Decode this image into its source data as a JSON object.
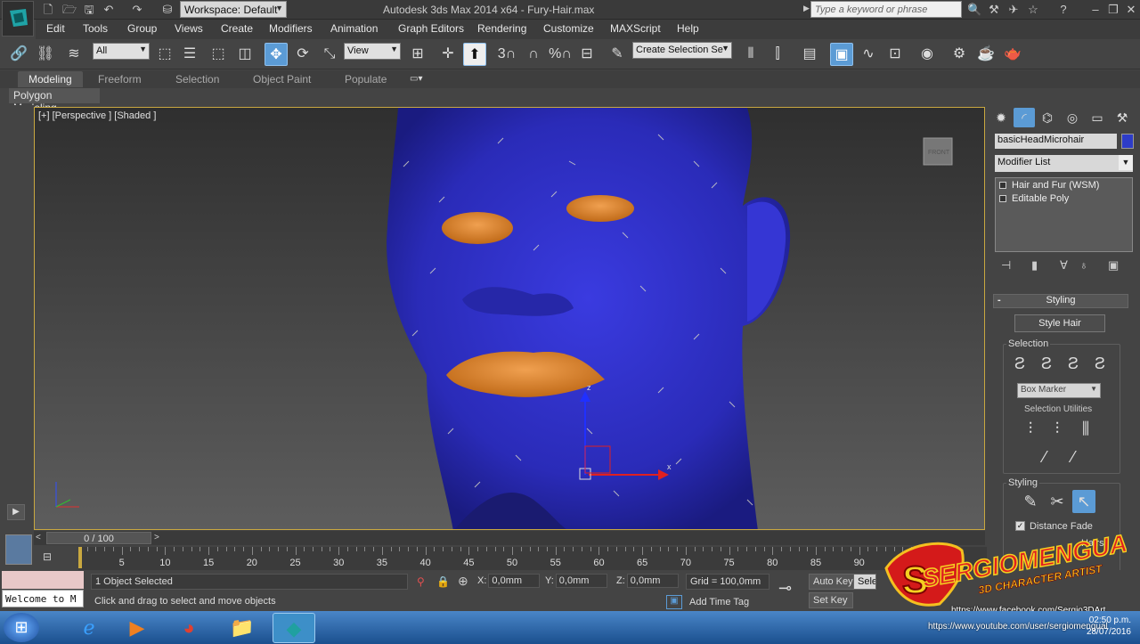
{
  "app": {
    "title": "Autodesk 3ds Max  2014 x64  -    Fury-Hair.max",
    "workspace": "Workspace: Default",
    "search_placeholder": "Type a keyword or phrase",
    "logo_icon": "3dsmax-logo-icon"
  },
  "menu": [
    "Edit",
    "Tools",
    "Group",
    "Views",
    "Create",
    "Modifiers",
    "Animation",
    "Graph Editors",
    "Rendering",
    "Customize",
    "MAXScript",
    "Help"
  ],
  "toolbar": {
    "selection_filter": "All",
    "reference_coord": "View",
    "named_selection": "Create Selection Se",
    "snap_labels": [
      "3",
      "%"
    ]
  },
  "ribbon": {
    "tabs": [
      "Modeling",
      "Freeform",
      "Selection",
      "Object Paint",
      "Populate"
    ],
    "active_tab": "Modeling",
    "panel": "Polygon Modeling"
  },
  "viewport": {
    "label": "[+] [Perspective ] [Shaded ]",
    "viewcube_label": "FRONT",
    "gizmo": {
      "x": "x",
      "y": "y",
      "z": "z"
    }
  },
  "command_panel": {
    "object_name": "basicHeadMicrohair",
    "object_color": "#2d3cc8",
    "modifier_list_label": "Modifier List",
    "stack": [
      "Hair and Fur (WSM)",
      "Editable Poly"
    ],
    "rollout_title": "Styling",
    "style_hair_label": "Style Hair",
    "selection_group": "Selection",
    "box_marker": "Box Marker",
    "selection_utilities": "Selection Utilities",
    "styling_group": "Styling",
    "distance_fade": "Distance Fade",
    "hairs_label": "Hairs"
  },
  "timeline": {
    "frame_display": "0 / 100",
    "ticks": [
      5,
      10,
      15,
      20,
      25,
      30,
      35,
      40,
      45,
      50,
      55,
      60,
      65,
      70,
      75,
      80,
      85,
      90
    ]
  },
  "status": {
    "welcome": "Welcome to M",
    "selected": "1 Object Selected",
    "prompt": "Click and drag to select and move objects",
    "x_label": "X:",
    "x": "0,0mm",
    "y_label": "Y:",
    "y": "0,0mm",
    "z_label": "Z:",
    "z": "0,0mm",
    "grid": "Grid = 100,0mm",
    "add_time_tag": "Add Time Tag",
    "auto_key": "Auto Key",
    "set_key": "Set Key",
    "selected_dd": "Selected"
  },
  "watermark": {
    "name": "SERGIOMENGUAL",
    "subtitle": "3D CHARACTER ARTIST",
    "facebook": "https://www.facebook.com/Sergio3DArt",
    "youtube": "https://www.youtube.com/user/sergiomengual"
  },
  "taskbar": {
    "time": "02:50 p.m.",
    "date": "28/07/2016",
    "items": [
      "internet-explorer-icon",
      "media-player-icon",
      "chrome-icon",
      "file-explorer-icon",
      "3dsmax-icon"
    ]
  },
  "colors": {
    "viewport_border": "#c9a840",
    "head": "#2d2ec4",
    "lips": "#e08a30",
    "active_blue": "#5b9bd5"
  }
}
